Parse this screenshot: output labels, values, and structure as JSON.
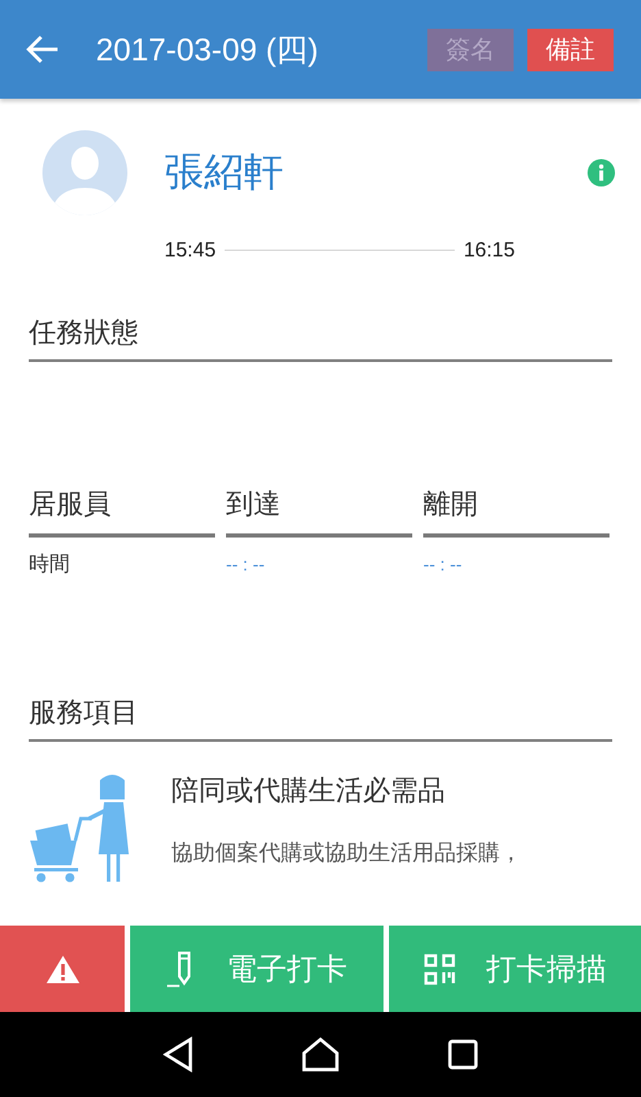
{
  "app_bar": {
    "title": "2017-03-09 (四)",
    "buttons": [
      {
        "label": "簽名",
        "disabled": true
      },
      {
        "label": "備註",
        "disabled": false
      }
    ]
  },
  "client": {
    "name": "張紹軒",
    "start_time": "15:45",
    "end_time": "16:15"
  },
  "task_status": {
    "heading": "任務狀態"
  },
  "attendance": {
    "columns": [
      "居服員",
      "到達",
      "離開"
    ],
    "row_label": "時間",
    "values": [
      "-- : --",
      "-- : --"
    ]
  },
  "services": {
    "heading": "服務項目",
    "items": [
      {
        "title": "陪同或代購生活必需品",
        "description": "協助個案代購或協助生活用品採購，"
      }
    ]
  },
  "bottom_actions": [
    {
      "kind": "alert"
    },
    {
      "kind": "sign",
      "label": "電子打卡"
    },
    {
      "kind": "scan",
      "label": "打卡掃描"
    }
  ]
}
